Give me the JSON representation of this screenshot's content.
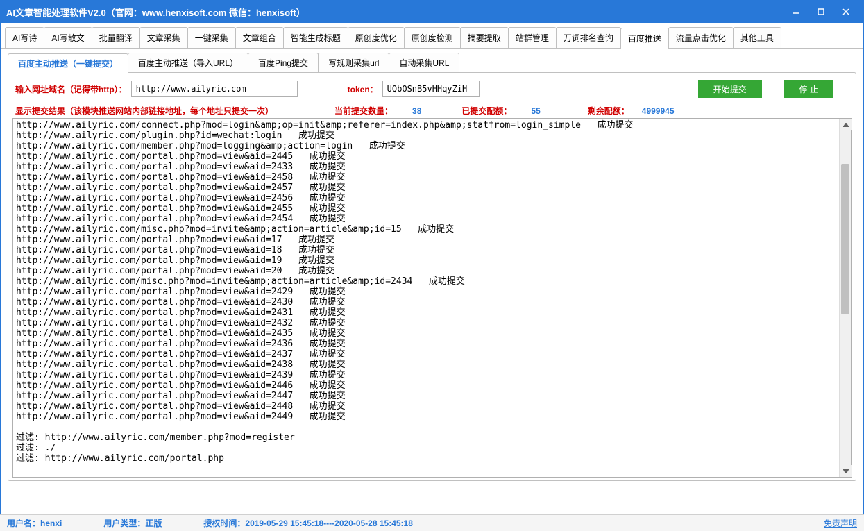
{
  "title": "AI文章智能处理软件V2.0（官网：www.henxisoft.com  微信：henxisoft）",
  "mainTabs": [
    "AI写诗",
    "AI写散文",
    "批量翻译",
    "文章采集",
    "一键采集",
    "文章组合",
    "智能生成标题",
    "原创度优化",
    "原创度检测",
    "摘要提取",
    "站群管理",
    "万词排名查询",
    "百度推送",
    "流量点击优化",
    "其他工具"
  ],
  "mainActive": 12,
  "subTabs": [
    "百度主动推送（一键提交）",
    "百度主动推送（导入URL）",
    "百度Ping提交",
    "写规则采集url",
    "自动采集URL"
  ],
  "subActive": 0,
  "form": {
    "urlLabel": "输入网址域名（记得带http）：",
    "urlValue": "http://www.ailyric.com",
    "tokenLabel": "token：",
    "tokenValue": "UQbOSnB5vHHqyZiH",
    "startBtn": "开始提交",
    "stopBtn": "停  止"
  },
  "stats": {
    "resultLabel": "显示提交结果（该模块推送网站内部链接地址，每个地址只提交一次）",
    "currentLabel": "当前提交数量：",
    "currentValue": "38",
    "submittedLabel": "已提交配额：",
    "submittedValue": "55",
    "remainLabel": "剩余配额：",
    "remainValue": "4999945"
  },
  "log": "http://www.ailyric.com/connect.php?mod=login&amp;op=init&amp;referer=index.php&amp;statfrom=login_simple   成功提交\nhttp://www.ailyric.com/plugin.php?id=wechat:login   成功提交\nhttp://www.ailyric.com/member.php?mod=logging&amp;action=login   成功提交\nhttp://www.ailyric.com/portal.php?mod=view&aid=2445   成功提交\nhttp://www.ailyric.com/portal.php?mod=view&aid=2433   成功提交\nhttp://www.ailyric.com/portal.php?mod=view&aid=2458   成功提交\nhttp://www.ailyric.com/portal.php?mod=view&aid=2457   成功提交\nhttp://www.ailyric.com/portal.php?mod=view&aid=2456   成功提交\nhttp://www.ailyric.com/portal.php?mod=view&aid=2455   成功提交\nhttp://www.ailyric.com/portal.php?mod=view&aid=2454   成功提交\nhttp://www.ailyric.com/misc.php?mod=invite&amp;action=article&amp;id=15   成功提交\nhttp://www.ailyric.com/portal.php?mod=view&aid=17   成功提交\nhttp://www.ailyric.com/portal.php?mod=view&aid=18   成功提交\nhttp://www.ailyric.com/portal.php?mod=view&aid=19   成功提交\nhttp://www.ailyric.com/portal.php?mod=view&aid=20   成功提交\nhttp://www.ailyric.com/misc.php?mod=invite&amp;action=article&amp;id=2434   成功提交\nhttp://www.ailyric.com/portal.php?mod=view&aid=2429   成功提交\nhttp://www.ailyric.com/portal.php?mod=view&aid=2430   成功提交\nhttp://www.ailyric.com/portal.php?mod=view&aid=2431   成功提交\nhttp://www.ailyric.com/portal.php?mod=view&aid=2432   成功提交\nhttp://www.ailyric.com/portal.php?mod=view&aid=2435   成功提交\nhttp://www.ailyric.com/portal.php?mod=view&aid=2436   成功提交\nhttp://www.ailyric.com/portal.php?mod=view&aid=2437   成功提交\nhttp://www.ailyric.com/portal.php?mod=view&aid=2438   成功提交\nhttp://www.ailyric.com/portal.php?mod=view&aid=2439   成功提交\nhttp://www.ailyric.com/portal.php?mod=view&aid=2446   成功提交\nhttp://www.ailyric.com/portal.php?mod=view&aid=2447   成功提交\nhttp://www.ailyric.com/portal.php?mod=view&aid=2448   成功提交\nhttp://www.ailyric.com/portal.php?mod=view&aid=2449   成功提交\n\n过滤: http://www.ailyric.com/member.php?mod=register\n过滤: ./\n过滤: http://www.ailyric.com/portal.php",
  "status": {
    "userLabel": "用户名：",
    "userValue": "henxi",
    "typeLabel": "用户类型：",
    "typeValue": "正版",
    "authLabel": "授权时间：",
    "authValue": "2019-05-29 15:45:18----2020-05-28 15:45:18",
    "disclaimer": "免责声明"
  }
}
